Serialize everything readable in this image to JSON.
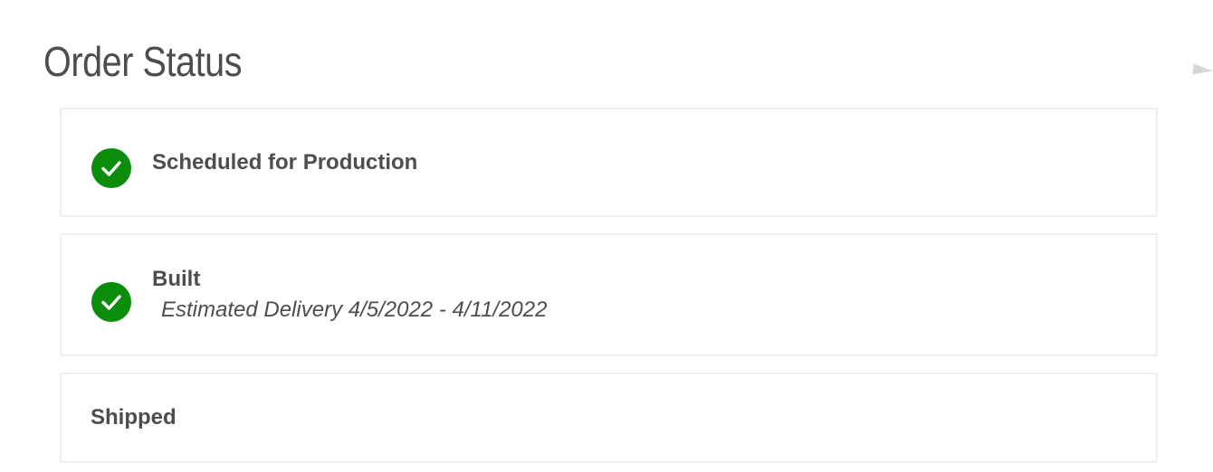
{
  "page": {
    "title": "Order Status"
  },
  "colors": {
    "check_green": "#0b8c0b",
    "text": "#4d4d4d",
    "card_border": "#efefef"
  },
  "statuses": [
    {
      "label": "Scheduled for Production",
      "detail": "",
      "completed": true,
      "icon": "check-circle-icon"
    },
    {
      "label": "Built",
      "detail": "Estimated Delivery 4/5/2022 - 4/11/2022",
      "completed": true,
      "icon": "check-circle-icon"
    },
    {
      "label": "Shipped",
      "detail": "",
      "completed": false,
      "icon": ""
    }
  ]
}
